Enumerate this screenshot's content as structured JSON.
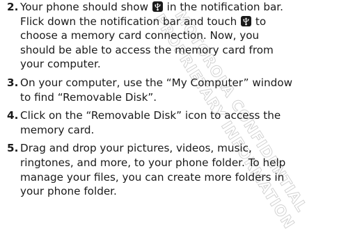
{
  "watermark": {
    "lines": [
      "MOTOROLA CONFIDENTIAL",
      "PROPRIETARY INFORMATION"
    ]
  },
  "steps": [
    {
      "number": "2.",
      "line1_a": "Your phone should show ",
      "line1_b": " in the notification bar.",
      "line2_a": "Flick down the notification bar and touch ",
      "line2_b": " to",
      "line3": "choose a memory card connection. Now, you",
      "line4": "should be able to access the memory card from",
      "line5": "your computer."
    },
    {
      "number": "3.",
      "lines": [
        "On your computer, use the “My Computer” window",
        "to find “Removable Disk”."
      ]
    },
    {
      "number": "4.",
      "lines": [
        "Click on the “Removable Disk” icon to access the",
        "memory card."
      ]
    },
    {
      "number": "5.",
      "lines": [
        "Drag and drop your pictures, videos, music,",
        "ringtones, and more, to your phone folder. To help",
        "manage your files, you can create more folders in",
        "your phone folder."
      ]
    }
  ],
  "icons": {
    "usb_notification": "usb-icon",
    "icon_background": "#1a1a1a",
    "icon_foreground": "#ffffff"
  }
}
